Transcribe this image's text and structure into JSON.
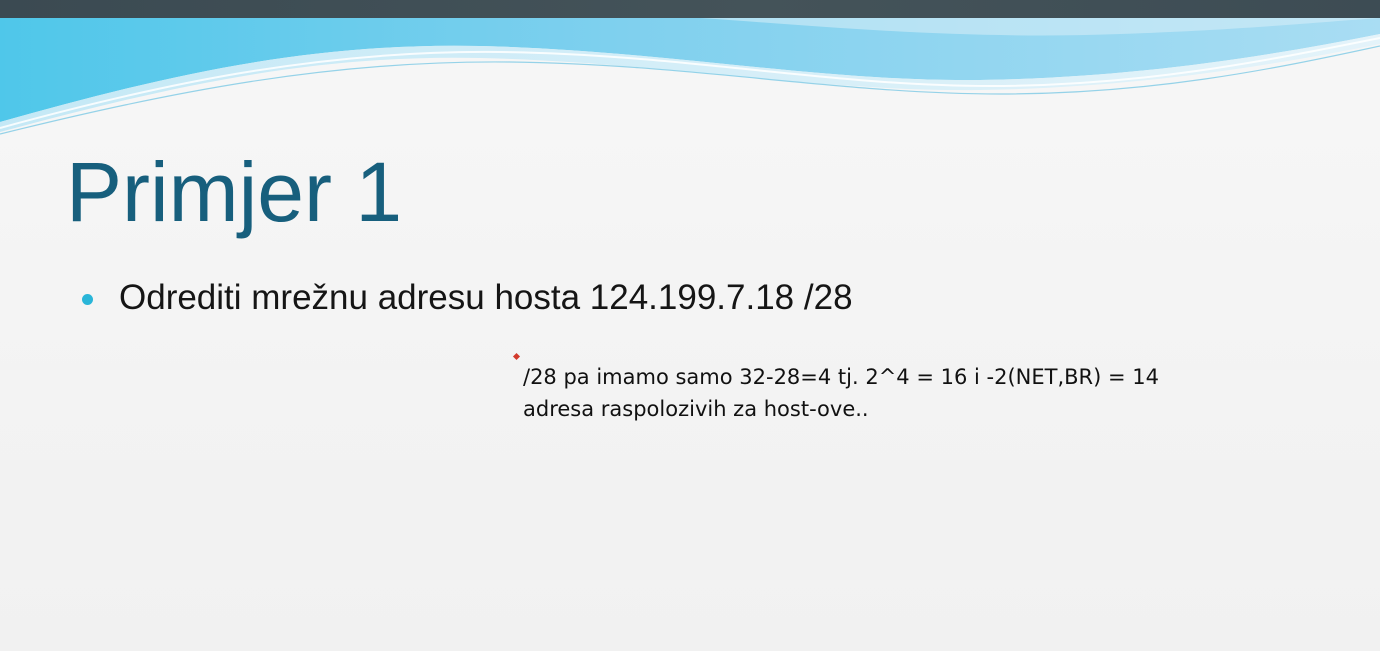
{
  "slide": {
    "title": "Primjer 1",
    "bullets": [
      "Odrediti mrežnu adresu hosta 124.199.7.18 /28"
    ],
    "note_lines": [
      "/28 pa imamo samo 32-28=4 tj. 2^4 = 16 i -2(NET,BR) = 14",
      "adresa raspolozivih za host-ove.."
    ]
  },
  "colors": {
    "title": "#175f7d",
    "bullet": "#29b5d8",
    "wave_light": "#8fd3ef",
    "wave_dark": "#3b4a52",
    "marker": "#d23a2c"
  }
}
